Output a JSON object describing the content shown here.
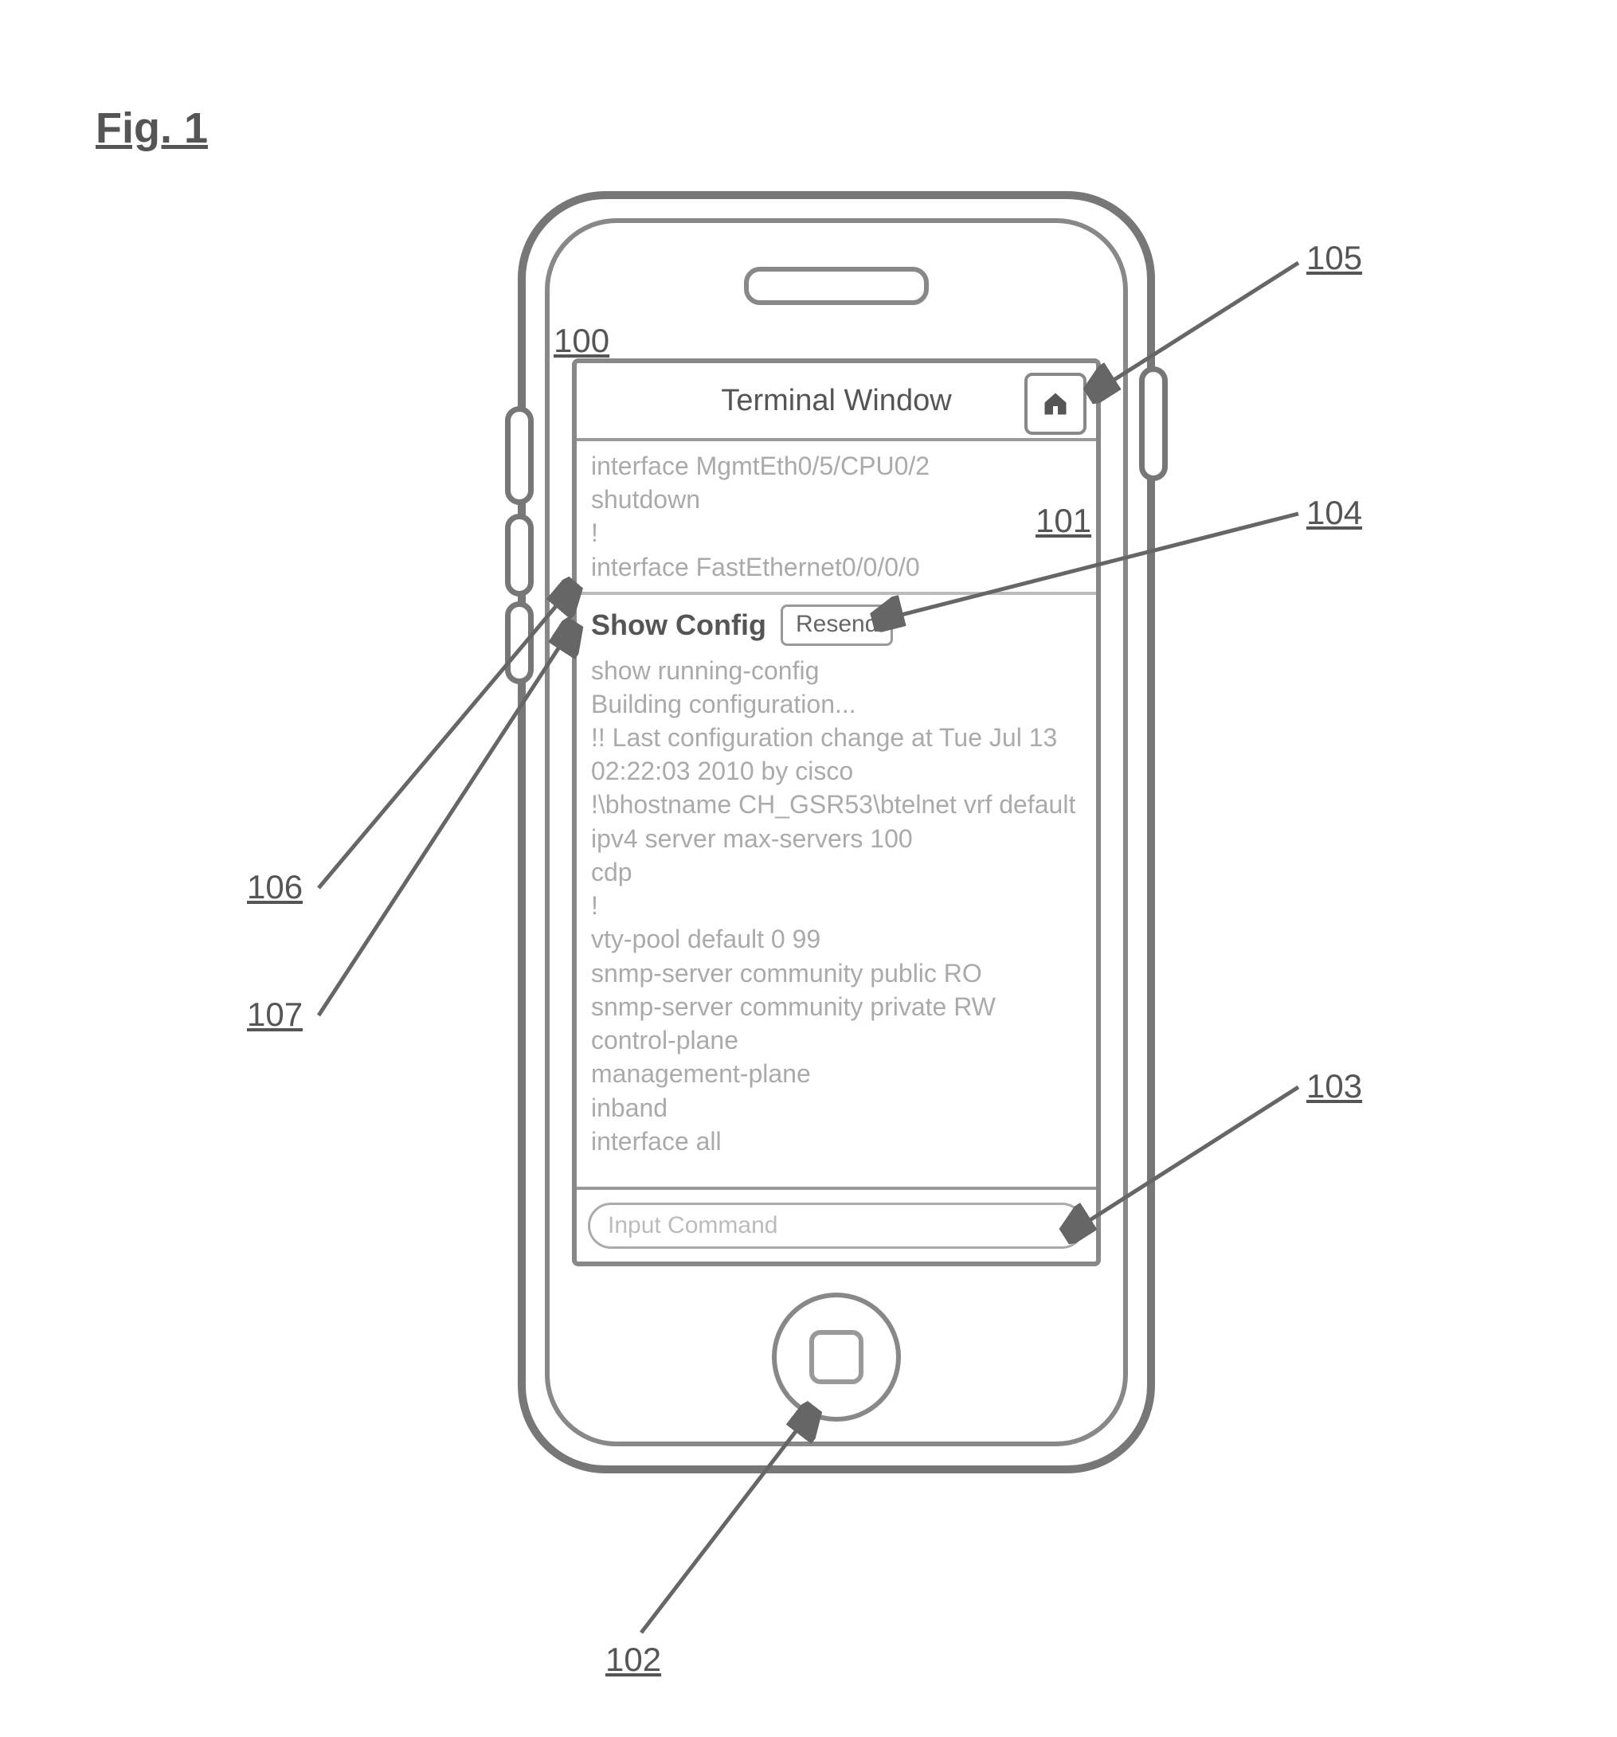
{
  "figure_label": "Fig. 1",
  "title": "Terminal Window",
  "home_icon_name": "home-icon",
  "terminal_top": [
    "interface MgmtEth0/5/CPU0/2",
    "shutdown",
    "!",
    "interface FastEthernet0/0/0/0"
  ],
  "section": {
    "label": "Show Config",
    "resend": "Resend"
  },
  "terminal_bottom": [
    "show running-config",
    "Building configuration...",
    "!! Last configuration change at Tue Jul 13",
    "02:22:03 2010 by cisco",
    "!\\bhostname CH_GSR53\\btelnet vrf default",
    "ipv4 server max-servers 100",
    "cdp",
    "!",
    "vty-pool default 0 99",
    "snmp-server community public RO",
    "snmp-server community private RW",
    "control-plane",
    "management-plane",
    "inband",
    "interface all"
  ],
  "input_placeholder": "Input Command",
  "callouts": {
    "c100": "100",
    "c101": "101",
    "c102": "102",
    "c103": "103",
    "c104": "104",
    "c105": "105",
    "c106": "106",
    "c107": "107"
  }
}
